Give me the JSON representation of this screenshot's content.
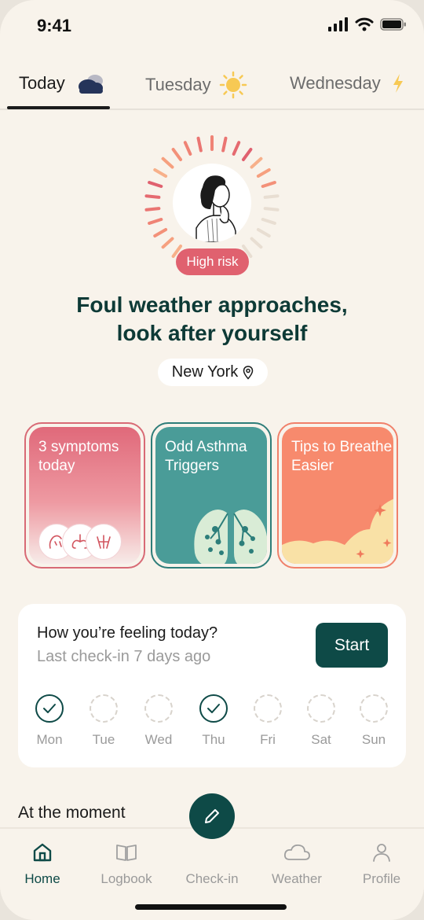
{
  "status_bar": {
    "time": "9:41"
  },
  "tabs": [
    {
      "label": "Today",
      "icon": "cloudy-icon",
      "active": true
    },
    {
      "label": "Tuesday",
      "icon": "sun-icon",
      "active": false
    },
    {
      "label": "Wednesday",
      "icon": "lightning-icon",
      "active": false
    }
  ],
  "hero": {
    "risk_label": "High risk",
    "headline_line1": "Foul weather approaches,",
    "headline_line2": "look after yourself",
    "location": "New York"
  },
  "cards": [
    {
      "title": "3 symptoms today",
      "color": "#e0697a"
    },
    {
      "title": "Odd Asthma Triggers",
      "color": "#4a9c98"
    },
    {
      "title": "Tips to Breathe Easier",
      "color": "#f78a6d"
    }
  ],
  "checkin": {
    "title": "How you’re feeling today?",
    "subtitle": "Last check-in 7 days ago",
    "start_label": "Start",
    "days": [
      {
        "label": "Mon",
        "done": true
      },
      {
        "label": "Tue",
        "done": false
      },
      {
        "label": "Wed",
        "done": false
      },
      {
        "label": "Thu",
        "done": true
      },
      {
        "label": "Fri",
        "done": false
      },
      {
        "label": "Sat",
        "done": false
      },
      {
        "label": "Sun",
        "done": false
      }
    ]
  },
  "section": {
    "at_the_moment": "At the moment"
  },
  "nav": [
    {
      "label": "Home",
      "icon": "home-icon",
      "active": true
    },
    {
      "label": "Logbook",
      "icon": "book-icon",
      "active": false
    },
    {
      "label": "Check-in",
      "icon": "pencil-icon",
      "active": false
    },
    {
      "label": "Weather",
      "icon": "cloud-icon",
      "active": false
    },
    {
      "label": "Profile",
      "icon": "person-icon",
      "active": false
    }
  ],
  "colors": {
    "primary": "#0e4a47",
    "risk": "#e0616f",
    "background": "#f8f3eb"
  }
}
